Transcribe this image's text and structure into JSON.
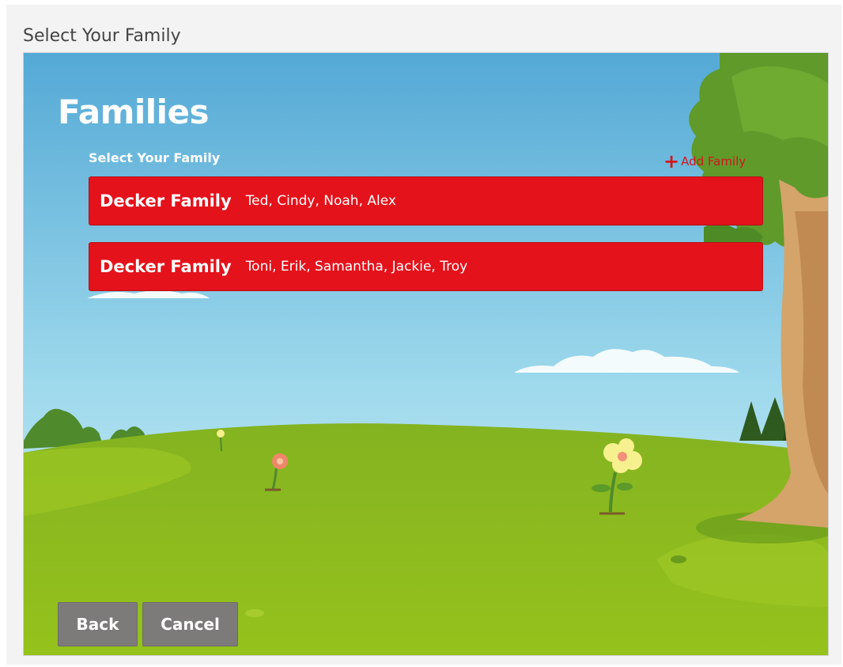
{
  "caption": "Select Your Family",
  "panel": {
    "title": "Families",
    "subtitle": "Select Your Family",
    "add_family": {
      "icon": "plus-icon",
      "label": "Add Family"
    }
  },
  "families": [
    {
      "name": "Decker Family",
      "members": "Ted, Cindy, Noah, Alex"
    },
    {
      "name": "Decker Family",
      "members": "Toni, Erik, Samantha, Jackie, Troy"
    }
  ],
  "footer": {
    "back_label": "Back",
    "cancel_label": "Cancel"
  },
  "colors": {
    "accent": "#e4121b",
    "add_link": "#d4161c",
    "button_gray": "#7c7b7a",
    "sky_top": "#5aaed8",
    "grass": "#8cb821"
  }
}
